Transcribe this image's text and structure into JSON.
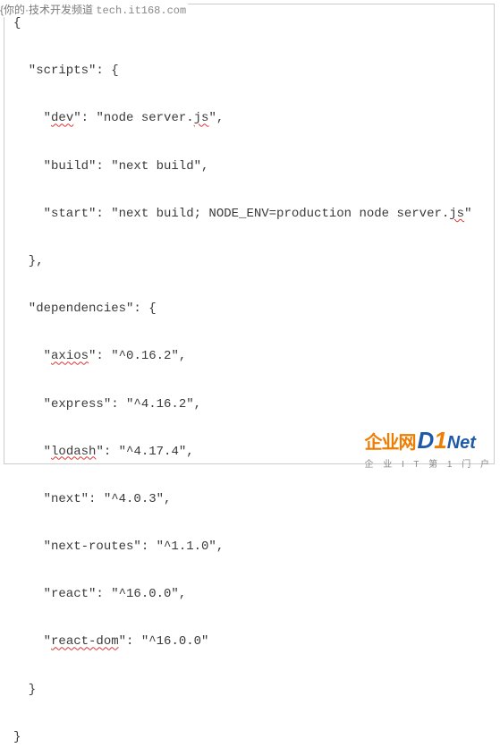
{
  "header": {
    "prefix": "{",
    "zh": "你的·技术开发频道",
    "url": "tech.it168.com"
  },
  "code": {
    "l1": "{",
    "scripts_open": "  \"scripts\": {",
    "dev_k": "    \"",
    "dev_name": "dev",
    "dev_rest": "\": \"node server.",
    "dev_js": "js",
    "dev_end": "\",",
    "build": "    \"build\": \"next build\",",
    "start_a": "    \"start\": \"next build; NODE_ENV=production node server.",
    "start_js": "js",
    "start_end": "\"",
    "scripts_close": "  },",
    "deps_open": "  \"dependencies\": {",
    "axios_a": "    \"",
    "axios_name": "axios",
    "axios_b": "\": \"^0.16.2\",",
    "express": "    \"express\": \"^4.16.2\",",
    "lodash_a": "    \"",
    "lodash_name": "lodash",
    "lodash_b": "\": \"^4.17.4\",",
    "next": "    \"next\": \"^4.0.3\",",
    "nextroutes": "    \"next-routes\": \"^1.1.0\",",
    "react": "    \"react\": \"^16.0.0\",",
    "reactdom_a": "    \"",
    "reactdom_name": "react-dom",
    "reactdom_b": "\": \"^16.0.0\"",
    "deps_close": "  }",
    "l_end": "}"
  },
  "watermark": {
    "brand_zh": "企业网",
    "brand_d": "D",
    "brand_1": "1",
    "brand_net": "Net",
    "sub": "企 业 I T 第 1 门 户"
  }
}
